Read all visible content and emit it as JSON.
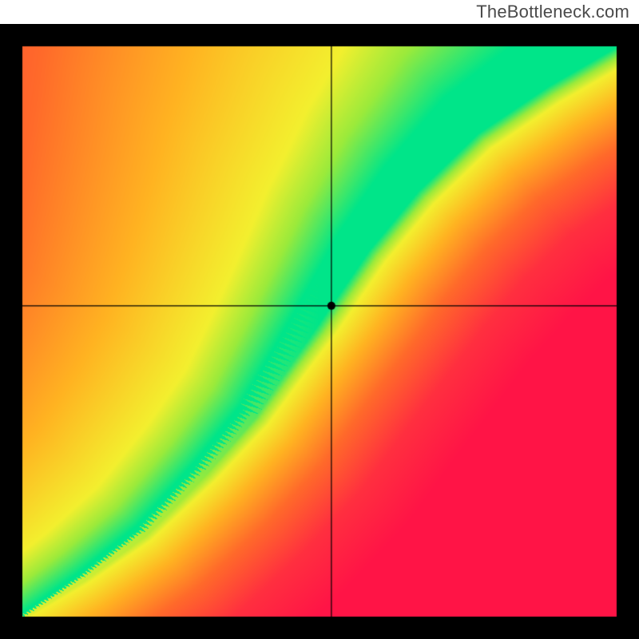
{
  "watermark": "TheBottleneck.com",
  "chart_data": {
    "type": "heatmap",
    "title": "",
    "xlabel": "",
    "ylabel": "",
    "xlim": [
      0,
      1
    ],
    "ylim": [
      0,
      1
    ],
    "border_color": "#000000",
    "border_px": 28,
    "crosshair": {
      "x": 0.52,
      "y": 0.545
    },
    "marker": {
      "x": 0.52,
      "y": 0.545,
      "radius": 5,
      "color": "#000000"
    },
    "color_stops": [
      {
        "d": 0.0,
        "color": "#00e589"
      },
      {
        "d": 0.05,
        "color": "#9bea3b"
      },
      {
        "d": 0.1,
        "color": "#f3ef2e"
      },
      {
        "d": 0.25,
        "color": "#ffb321"
      },
      {
        "d": 0.45,
        "color": "#ff6a2a"
      },
      {
        "d": 0.7,
        "color": "#ff2f3f"
      },
      {
        "d": 1.0,
        "color": "#ff1446"
      }
    ],
    "ridge": {
      "points": [
        {
          "x": 0.0,
          "y": 0.0,
          "w": 0.01
        },
        {
          "x": 0.1,
          "y": 0.07,
          "w": 0.018
        },
        {
          "x": 0.2,
          "y": 0.15,
          "w": 0.024
        },
        {
          "x": 0.3,
          "y": 0.26,
          "w": 0.03
        },
        {
          "x": 0.38,
          "y": 0.36,
          "w": 0.034
        },
        {
          "x": 0.44,
          "y": 0.46,
          "w": 0.04
        },
        {
          "x": 0.5,
          "y": 0.56,
          "w": 0.05
        },
        {
          "x": 0.56,
          "y": 0.66,
          "w": 0.06
        },
        {
          "x": 0.64,
          "y": 0.77,
          "w": 0.072
        },
        {
          "x": 0.74,
          "y": 0.88,
          "w": 0.085
        },
        {
          "x": 0.86,
          "y": 0.97,
          "w": 0.095
        },
        {
          "x": 1.0,
          "y": 1.06,
          "w": 0.105
        }
      ]
    },
    "asymmetry": {
      "comment": "distance falloff is scaled differently depending on which side of the ridge you are and where on the canvas; these multipliers shape the yellow/orange lobe to the upper-right and the red to the lower-left",
      "above_right_scale": 0.55,
      "below_left_scale": 1.35,
      "top_right_boost": 0.4,
      "bottom_left_boost": 0.0
    }
  }
}
